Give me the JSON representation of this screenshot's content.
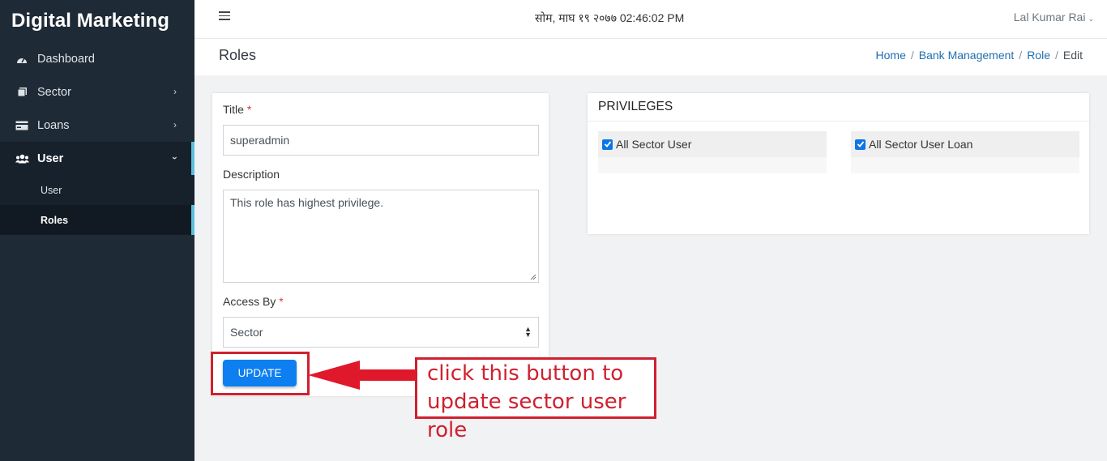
{
  "brand": "Digital Marketing",
  "sidebar": {
    "items": [
      {
        "label": "Dashboard",
        "icon": "dashboard-icon"
      },
      {
        "label": "Sector",
        "icon": "sector-icon"
      },
      {
        "label": "Loans",
        "icon": "loans-icon"
      },
      {
        "label": "User",
        "icon": "users-icon"
      }
    ],
    "subitems": [
      {
        "label": "User"
      },
      {
        "label": "Roles"
      }
    ]
  },
  "topbar": {
    "datetime": "सोम, माघ १९ २०७७ 02:46:02 PM",
    "user_name": "Lal Kumar Rai"
  },
  "page": {
    "title": "Roles",
    "breadcrumb": [
      "Home",
      "Bank Management",
      "Role",
      "Edit"
    ]
  },
  "form": {
    "title_label": "Title",
    "title_value": "superadmin",
    "description_label": "Description",
    "description_value": "This role has highest privilege.",
    "access_label": "Access By",
    "access_value": "Sector",
    "required_mark": "*",
    "update_label": "UPDATE"
  },
  "privileges": {
    "heading": "PRIVILEGES",
    "items": [
      {
        "label": "All Sector User",
        "checked": true
      },
      {
        "label": "All Sector User Loan",
        "checked": true
      }
    ]
  },
  "annotation": {
    "line1": "click this button to",
    "line2": "update sector user role"
  },
  "colors": {
    "sidebar_bg": "#1e2a36",
    "accent": "#5bc0de",
    "button": "#0d7ff0",
    "annotation": "#d0202f"
  }
}
